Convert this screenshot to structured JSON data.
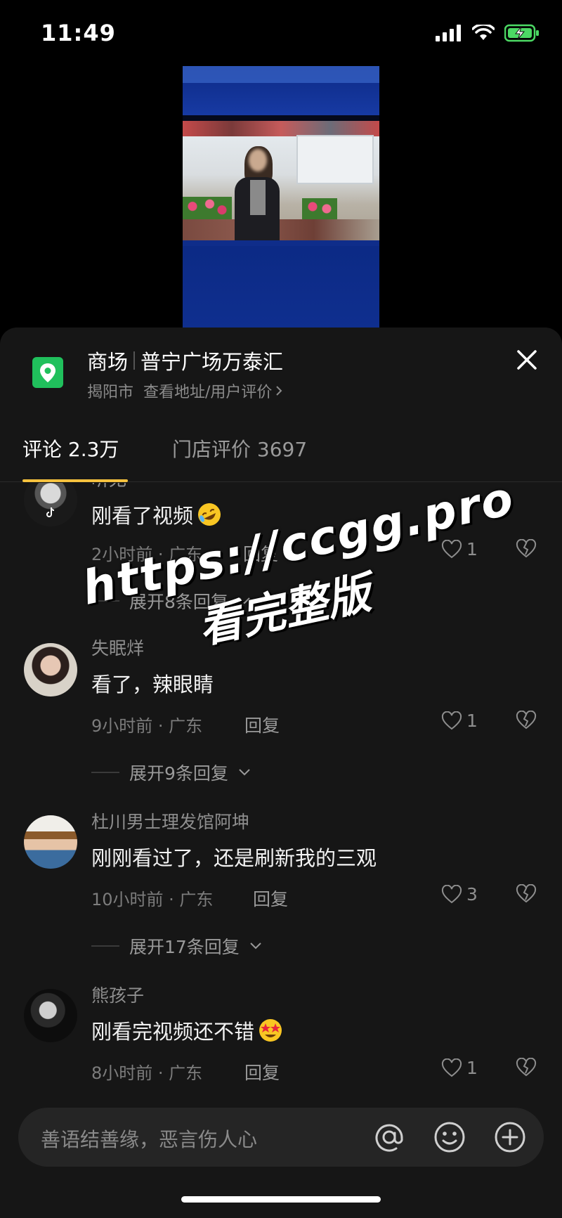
{
  "status_bar": {
    "time": "11:49"
  },
  "location": {
    "category": "商场",
    "name": "普宁广场万泰汇",
    "city": "揭阳市",
    "link_text": "查看地址/用户评价"
  },
  "tabs": [
    {
      "label": "评论 2.3万",
      "active": true
    },
    {
      "label": "门店评价 3697",
      "active": false
    }
  ],
  "comments": [
    {
      "username": "听无",
      "text": "刚看了视频",
      "emoji": "rofl",
      "time_region": "2小时前 · 广东",
      "reply_label": "回复",
      "likes": "1",
      "expand": "展开8条回复"
    },
    {
      "username": "失眠烊",
      "text": "看了，辣眼睛",
      "emoji": "",
      "time_region": "9小时前 · 广东",
      "reply_label": "回复",
      "likes": "1",
      "expand": "展开9条回复"
    },
    {
      "username": "杜川男士理发馆阿坤",
      "text": "刚刚看过了，还是刷新我的三观",
      "emoji": "",
      "time_region": "10小时前 · 广东",
      "reply_label": "回复",
      "likes": "3",
      "expand": "展开17条回复"
    },
    {
      "username": "熊孩子",
      "text": "刚看完视频还不错",
      "emoji": "star-struck",
      "time_region": "8小时前 · 广东",
      "reply_label": "回复",
      "likes": "1",
      "expand": ""
    }
  ],
  "watermark": {
    "line1": "https://ccgg.pro",
    "line2": "看完整版"
  },
  "input": {
    "placeholder": "善语结善缘，恶言伤人心"
  },
  "colors": {
    "accent_underline": "#f6c23e",
    "poi_icon": "#20c05c",
    "battery": "#4cd964"
  }
}
